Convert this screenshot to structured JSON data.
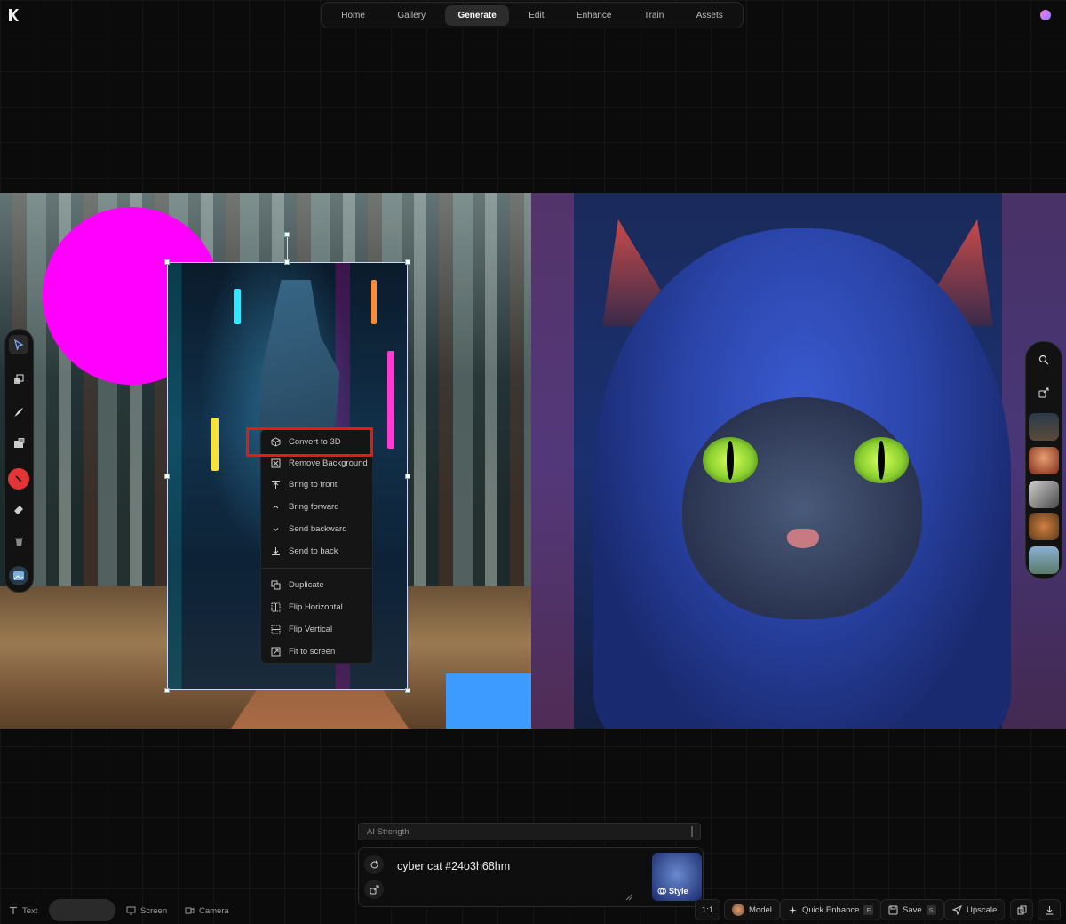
{
  "topnav": {
    "tabs": [
      {
        "label": "Home"
      },
      {
        "label": "Gallery"
      },
      {
        "label": "Generate",
        "active": true
      },
      {
        "label": "Edit"
      },
      {
        "label": "Enhance"
      },
      {
        "label": "Train"
      },
      {
        "label": "Assets"
      }
    ]
  },
  "left_toolbar": {
    "tools": [
      "select-cursor-icon",
      "layers-icon",
      "brush-icon",
      "image-add-icon",
      "color-picker-icon",
      "eraser-icon",
      "trash-icon",
      "image-upload-icon"
    ],
    "active_color": "#e23636"
  },
  "canvas": {
    "shapes": {
      "circle_color": "#ff00ff",
      "square_color": "#3d9bff"
    }
  },
  "context_menu": {
    "items": [
      {
        "label": "Convert to 3D",
        "icon": "cube-icon",
        "highlighted": true
      },
      {
        "label": "Remove Background",
        "icon": "remove-bg-icon"
      },
      {
        "label": "Bring to front",
        "icon": "arrow-to-top-icon"
      },
      {
        "label": "Bring forward",
        "icon": "chevron-up-icon"
      },
      {
        "label": "Send backward",
        "icon": "chevron-down-icon"
      },
      {
        "label": "Send to back",
        "icon": "arrow-to-bottom-icon"
      },
      {
        "label": "Duplicate",
        "icon": "duplicate-icon"
      },
      {
        "label": "Flip Horizontal",
        "icon": "flip-horizontal-icon"
      },
      {
        "label": "Flip Vertical",
        "icon": "flip-vertical-icon"
      },
      {
        "label": "Fit to screen",
        "icon": "fit-screen-icon"
      }
    ],
    "highlight_color": "#e8190f"
  },
  "right_toolbar": {
    "icons": [
      "search-icon",
      "share-icon"
    ],
    "thumbnails": [
      "thumb-cyber-scene",
      "thumb-portrait-red",
      "thumb-mech",
      "thumb-tiger",
      "thumb-landscape"
    ]
  },
  "prompt": {
    "strength_label": "AI Strength",
    "text": "cyber cat #24o3h68hm",
    "style_label": "Style"
  },
  "bottom_left": {
    "text_label": "Text",
    "screen_label": "Screen",
    "camera_label": "Camera"
  },
  "bottom_right": {
    "ratio": "1:1",
    "model_label": "Model",
    "quick_enhance_label": "Quick Enhance",
    "quick_enhance_key": "E",
    "save_label": "Save",
    "save_key": "S",
    "upscale_label": "Upscale"
  }
}
